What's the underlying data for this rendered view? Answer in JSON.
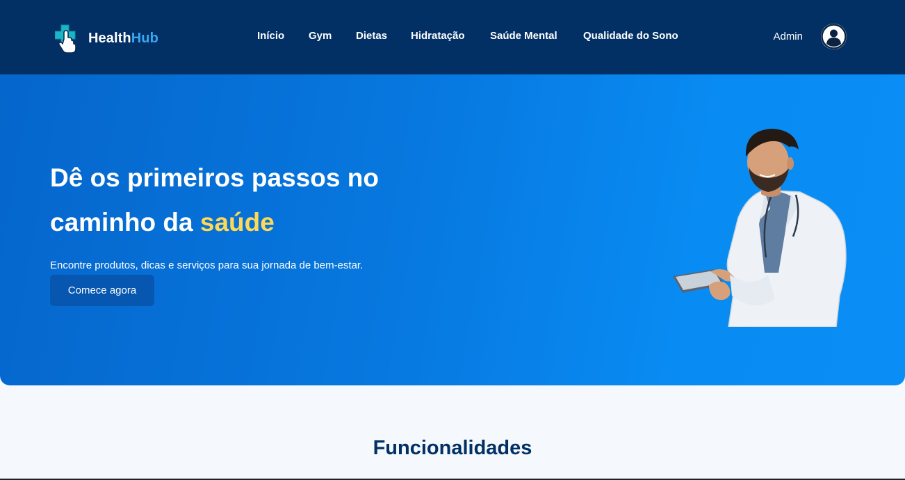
{
  "brand": {
    "name_part1": "Health",
    "name_part2": "Hub",
    "icon": "medical-cross-pointer-icon"
  },
  "nav": {
    "items": [
      {
        "label": "Início"
      },
      {
        "label": "Gym"
      },
      {
        "label": "Dietas"
      },
      {
        "label": "Hidratação"
      },
      {
        "label": "Saúde Mental"
      },
      {
        "label": "Qualidade do Sono"
      }
    ]
  },
  "user": {
    "name": "Admin",
    "avatar_icon": "user-avatar-icon"
  },
  "hero": {
    "title_line1": "Dê os primeiros passos no",
    "title_line2_prefix": "caminho da ",
    "title_highlight": "saúde",
    "subtitle": "Encontre produtos, dicas e serviços para sua jornada de bem-estar.",
    "cta_label": "Comece agora",
    "image": "doctor-with-tablet-illustration"
  },
  "features": {
    "title": "Funcionalidades"
  },
  "colors": {
    "header_bg": "#023065",
    "hero_gradient_start": "#0566cc",
    "hero_gradient_end": "#0a8ef5",
    "accent_yellow": "#ffd956",
    "brand_blue": "#39a8ef",
    "cta_bg": "#0756b0"
  }
}
